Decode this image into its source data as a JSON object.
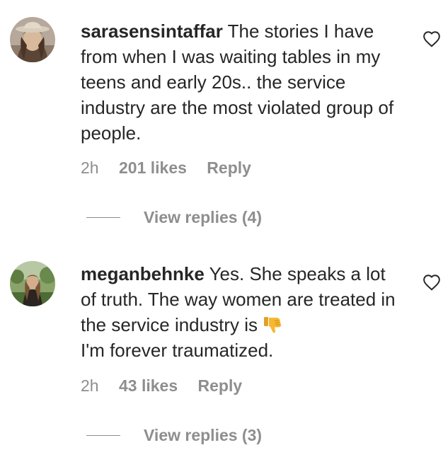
{
  "comments": [
    {
      "username": "sarasensintaffar",
      "text": "The stories I have from when I was waiting tables in my teens and early 20s.. the service industry are the most violated group of people.",
      "time": "2h",
      "likes": "201 likes",
      "reply_label": "Reply",
      "view_replies": "View replies (4)",
      "avatar_icon": "user-avatar"
    },
    {
      "username": "meganbehnke",
      "text": "Yes. She speaks a lot of truth. The way women are treated in the service industry is",
      "text_after_emoji": "I'm forever traumatized.",
      "emoji": "thumbs-down-emoji",
      "time": "2h",
      "likes": "43 likes",
      "reply_label": "Reply",
      "view_replies": "View replies (3)",
      "avatar_icon": "user-avatar"
    }
  ],
  "icons": {
    "like": "heart-outline-icon"
  },
  "colors": {
    "text": "#262626",
    "muted": "#8e8e8e",
    "background": "#ffffff",
    "emoji": "#f7b731"
  }
}
